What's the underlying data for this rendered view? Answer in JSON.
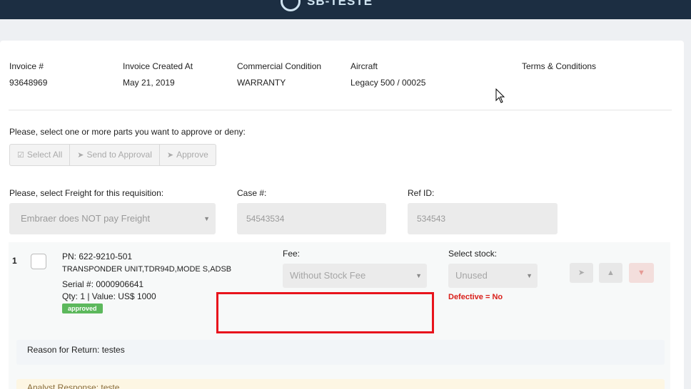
{
  "header": {
    "brand": "SB-TESTE"
  },
  "invoice": {
    "fields": [
      {
        "label": "Invoice #",
        "value": "93648969"
      },
      {
        "label": "Invoice Created At",
        "value": "May 21, 2019"
      },
      {
        "label": "Commercial Condition",
        "value": "WARRANTY"
      },
      {
        "label": "Aircraft",
        "value": "Legacy 500 / 00025"
      },
      {
        "label": "Terms & Conditions",
        "value": ""
      }
    ]
  },
  "parts_section": {
    "instruction": "Please, select one or more parts you want to approve or deny:",
    "buttons": {
      "select_all": "Select All",
      "send_to_approval": "Send to Approval",
      "approve": "Approve"
    }
  },
  "freight": {
    "label": "Please, select Freight for this requisition:",
    "selected": "Embraer does NOT pay Freight"
  },
  "case": {
    "label": "Case #:",
    "value": "54543534"
  },
  "ref": {
    "label": "Ref ID:",
    "value": "534543"
  },
  "part": {
    "index": "1",
    "pn": "PN: 622-9210-501",
    "description": "TRANSPONDER UNIT,TDR94D,MODE S,ADSB",
    "serial": "Serial #: 0000906641",
    "qty_value": "Qty: 1 | Value: US$ 1000",
    "status": "approved",
    "fee_label": "Fee:",
    "fee_selected": "Without Stock Fee",
    "stock_label": "Select stock:",
    "stock_selected": "Unused",
    "defective": "Defective = No"
  },
  "reason": "Reason for Return: testes",
  "analyst": "Analyst Response: teste",
  "colors": {
    "topbar": "#1c2e42",
    "badge": "#5cb85c",
    "defective": "#d9201b",
    "highlight": "#e8141c"
  }
}
